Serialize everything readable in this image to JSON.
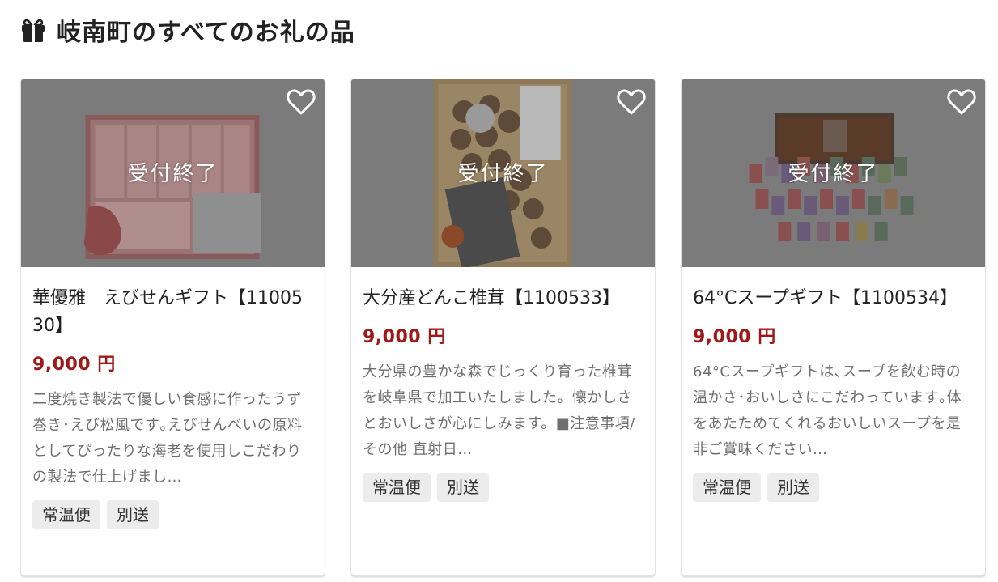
{
  "section": {
    "icon": "gift-icon",
    "title": "岐南町のすべてのお礼の品"
  },
  "colors": {
    "price": "#a01818",
    "overlay": "#7b7b7b",
    "tag_bg": "#ececec",
    "desc_text": "#6e6e6e"
  },
  "products": [
    {
      "status": "受付終了",
      "favorite_icon": "heart-outline-icon",
      "title": "華優雅　えびせんギフト【1100530】",
      "price": "9,000 円",
      "description": "二度焼き製法で優しい食感に作ったうず巻き･えび松風です｡えびせんべいの原料としてぴったりな海老を使用しこだわりの製法で仕上げまし…",
      "tags": [
        "常温便",
        "別送"
      ]
    },
    {
      "status": "受付終了",
      "favorite_icon": "heart-outline-icon",
      "title": "大分産どんこ椎茸【1100533】",
      "price": "9,000 円",
      "description": "大分県の豊かな森でじっくり育った椎茸を岐阜県で加工いたしました。懐かしさとおいしさが心にしみます。■注意事項/その他 直射日…",
      "tags": [
        "常温便",
        "別送"
      ]
    },
    {
      "status": "受付終了",
      "favorite_icon": "heart-outline-icon",
      "title": "64°Cスープギフト【1100534】",
      "price": "9,000 円",
      "description": "64°Cスープギフトは､スープを飲む時の温かさ･おいしさにこだわっています｡体をあたためてくれるおいしいスープを是非ご賞味ください…",
      "tags": [
        "常温便",
        "別送"
      ]
    }
  ]
}
